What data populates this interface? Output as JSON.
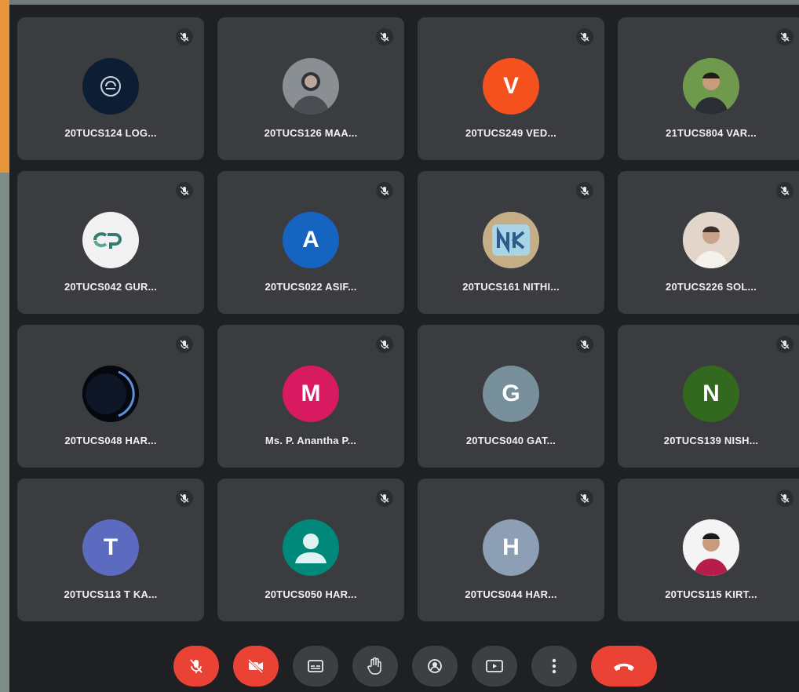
{
  "participants": [
    {
      "name": "20TUCS124 LOG...",
      "avatar": {
        "type": "image",
        "icon": "logo-icon",
        "color": "#0d1d33"
      }
    },
    {
      "name": "20TUCS126 MAA...",
      "avatar": {
        "type": "image",
        "icon": "person-photo-icon",
        "color": "#8a8f94"
      }
    },
    {
      "name": "20TUCS249 VED...",
      "avatar": {
        "type": "letter",
        "letter": "V",
        "color": "#f4511e"
      }
    },
    {
      "name": "21TUCS804 VAR...",
      "avatar": {
        "type": "image",
        "icon": "person-photo-icon",
        "color": "#4f7a3a"
      }
    },
    {
      "name": "20TUCS042 GUR...",
      "avatar": {
        "type": "image",
        "icon": "logo-icon",
        "color": "#f2f2f2"
      }
    },
    {
      "name": "20TUCS022 ASIF...",
      "avatar": {
        "type": "letter",
        "letter": "A",
        "color": "#1565c0"
      }
    },
    {
      "name": "20TUCS161 NITHI...",
      "avatar": {
        "type": "image",
        "icon": "nk-logo-icon",
        "color": "#9cc7d8"
      }
    },
    {
      "name": "20TUCS226 SOL...",
      "avatar": {
        "type": "image",
        "icon": "person-photo-icon",
        "color": "#d9cbbf"
      }
    },
    {
      "name": "20TUCS048 HAR...",
      "avatar": {
        "type": "image",
        "icon": "dark-planet-icon",
        "color": "#0c1220"
      }
    },
    {
      "name": "Ms. P. Anantha P...",
      "avatar": {
        "type": "letter",
        "letter": "M",
        "color": "#d81b60"
      }
    },
    {
      "name": "20TUCS040 GAT...",
      "avatar": {
        "type": "letter",
        "letter": "G",
        "color": "#78909c"
      }
    },
    {
      "name": "20TUCS139 NISH...",
      "avatar": {
        "type": "letter",
        "letter": "N",
        "color": "#33691e"
      }
    },
    {
      "name": "20TUCS113 T KA...",
      "avatar": {
        "type": "letter",
        "letter": "T",
        "color": "#5c6bc0"
      }
    },
    {
      "name": "20TUCS050 HAR...",
      "avatar": {
        "type": "image",
        "icon": "default-person-icon",
        "color": "#00897b"
      }
    },
    {
      "name": "20TUCS044 HAR...",
      "avatar": {
        "type": "letter",
        "letter": "H",
        "color": "#8d9fb4"
      }
    },
    {
      "name": "20TUCS115 KIRT...",
      "avatar": {
        "type": "image",
        "icon": "person-photo-icon",
        "color": "#f3f3f3"
      }
    }
  ],
  "controls": [
    {
      "name": "mic-toggle-button",
      "icon": "mic-off-icon",
      "color": "#ea4335"
    },
    {
      "name": "camera-toggle-button",
      "icon": "camera-off-icon",
      "color": "#ea4335"
    },
    {
      "name": "captions-button",
      "icon": "captions-icon",
      "color": "#3c4043"
    },
    {
      "name": "raise-hand-button",
      "icon": "hand-icon",
      "color": "#3c4043"
    },
    {
      "name": "effects-button",
      "icon": "effects-icon",
      "color": "#3c4043"
    },
    {
      "name": "present-screen-button",
      "icon": "present-icon",
      "color": "#3c4043"
    },
    {
      "name": "more-options-button",
      "icon": "more-vert-icon",
      "color": "#3c4043"
    },
    {
      "name": "end-call-button",
      "icon": "hang-up-icon",
      "color": "#ea4335"
    }
  ]
}
